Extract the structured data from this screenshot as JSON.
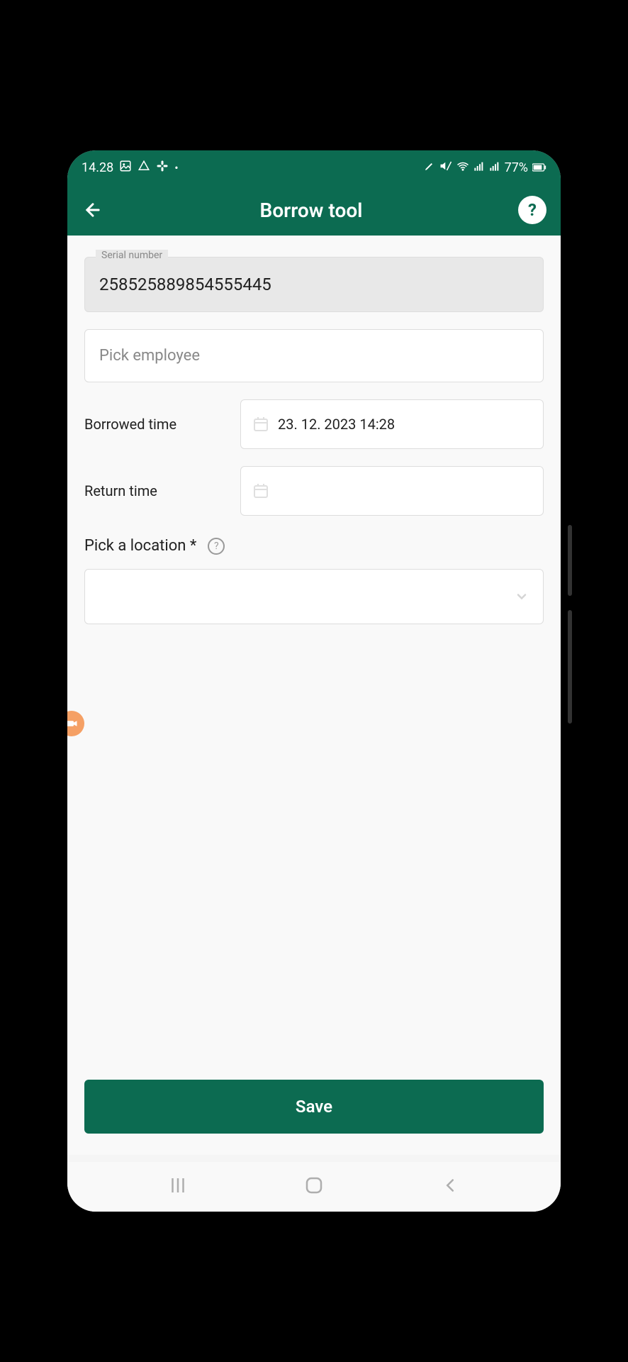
{
  "status_bar": {
    "time": "14.28",
    "battery": "77%"
  },
  "header": {
    "title": "Borrow tool"
  },
  "form": {
    "serial_number": {
      "label": "Serial number",
      "value": "258525889854555445"
    },
    "employee": {
      "placeholder": "Pick employee"
    },
    "borrowed_time": {
      "label": "Borrowed time",
      "value": "23. 12. 2023 14:28"
    },
    "return_time": {
      "label": "Return time",
      "value": ""
    },
    "location": {
      "label": "Pick a location *"
    }
  },
  "actions": {
    "save": "Save"
  }
}
